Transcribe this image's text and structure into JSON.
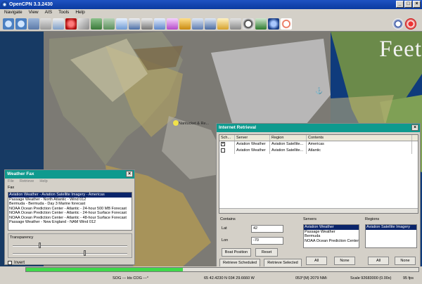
{
  "window": {
    "title": "OpenCPN 3.3.2430"
  },
  "menu": [
    "Navigate",
    "View",
    "AIS",
    "Tools",
    "Help"
  ],
  "map": {
    "watermark": "Feet",
    "place_label": "Nantucket & Re..."
  },
  "weather_fax": {
    "title": "Weather Fax",
    "menu": [
      "File",
      "Retrieve",
      "Help"
    ],
    "fax_label": "Fax",
    "items": [
      "Aviation Weather - Aviation Satellite Imagery - Americas",
      "Passage Weather - North Atlantic - Wind 012",
      "Bermuda - Bermuda - Day 3 Marine forecast",
      "NOAA Ocean Prediction Center - Atlantic - 24-hour 500 MB Forecast",
      "NOAA Ocean Prediction Center - Atlantic - 24-hour Surface Forecast",
      "NOAA Ocean Prediction Center - Atlantic - 48-hour Surface Forecast",
      "Passage Weather - New England - NAM Wind 012"
    ],
    "selected_index": 0,
    "transparency_label": "Transparency",
    "invert_label": "Invert"
  },
  "internet_retrieval": {
    "title": "Internet Retrieval",
    "columns": [
      "Sch...",
      "Server",
      "Region",
      "Contents"
    ],
    "rows": [
      {
        "server": "Aviation Weather",
        "region": "Aviation Satellite...",
        "contents": "Americas",
        "checked": true
      },
      {
        "server": "Aviation Weather",
        "region": "Aviation Satellite...",
        "contents": "Atlantic",
        "checked": false
      }
    ],
    "contains_label": "Contains",
    "lat_label": "Lat",
    "lat_value": "42",
    "lon_label": "Lon",
    "lon_value": "-70",
    "boat_position_label": "Boat Position",
    "reset_label": "Reset",
    "servers_label": "Servers",
    "servers": [
      "Aviation Weather",
      "Passage Weather",
      "Bermuda",
      "NOAA Ocean Prediction Center"
    ],
    "servers_selected": 0,
    "regions_label": "Regions",
    "regions": [
      "Aviation Satellite Imagery"
    ],
    "regions_selected": 0,
    "all_label": "All",
    "none_label": "None",
    "retrieve_scheduled_label": "Retrieve Scheduled",
    "retrieve_selected_label": "Retrieve Selected"
  },
  "status": {
    "sog": "SOG --- kts COG ---°",
    "position": "65 42.4230 N   034 29.6660 W",
    "bearing": "053°(M)  2079 NMi",
    "scale": "Scale 92683000 (0.00x)",
    "fps": "95 fps"
  },
  "progress": {
    "fill_fraction": 0.4
  },
  "colors": {
    "title_bar": "#1f53c2",
    "panel_title": "#0e9a8e",
    "selection": "#0a246a",
    "progress": "#3fd94a"
  }
}
